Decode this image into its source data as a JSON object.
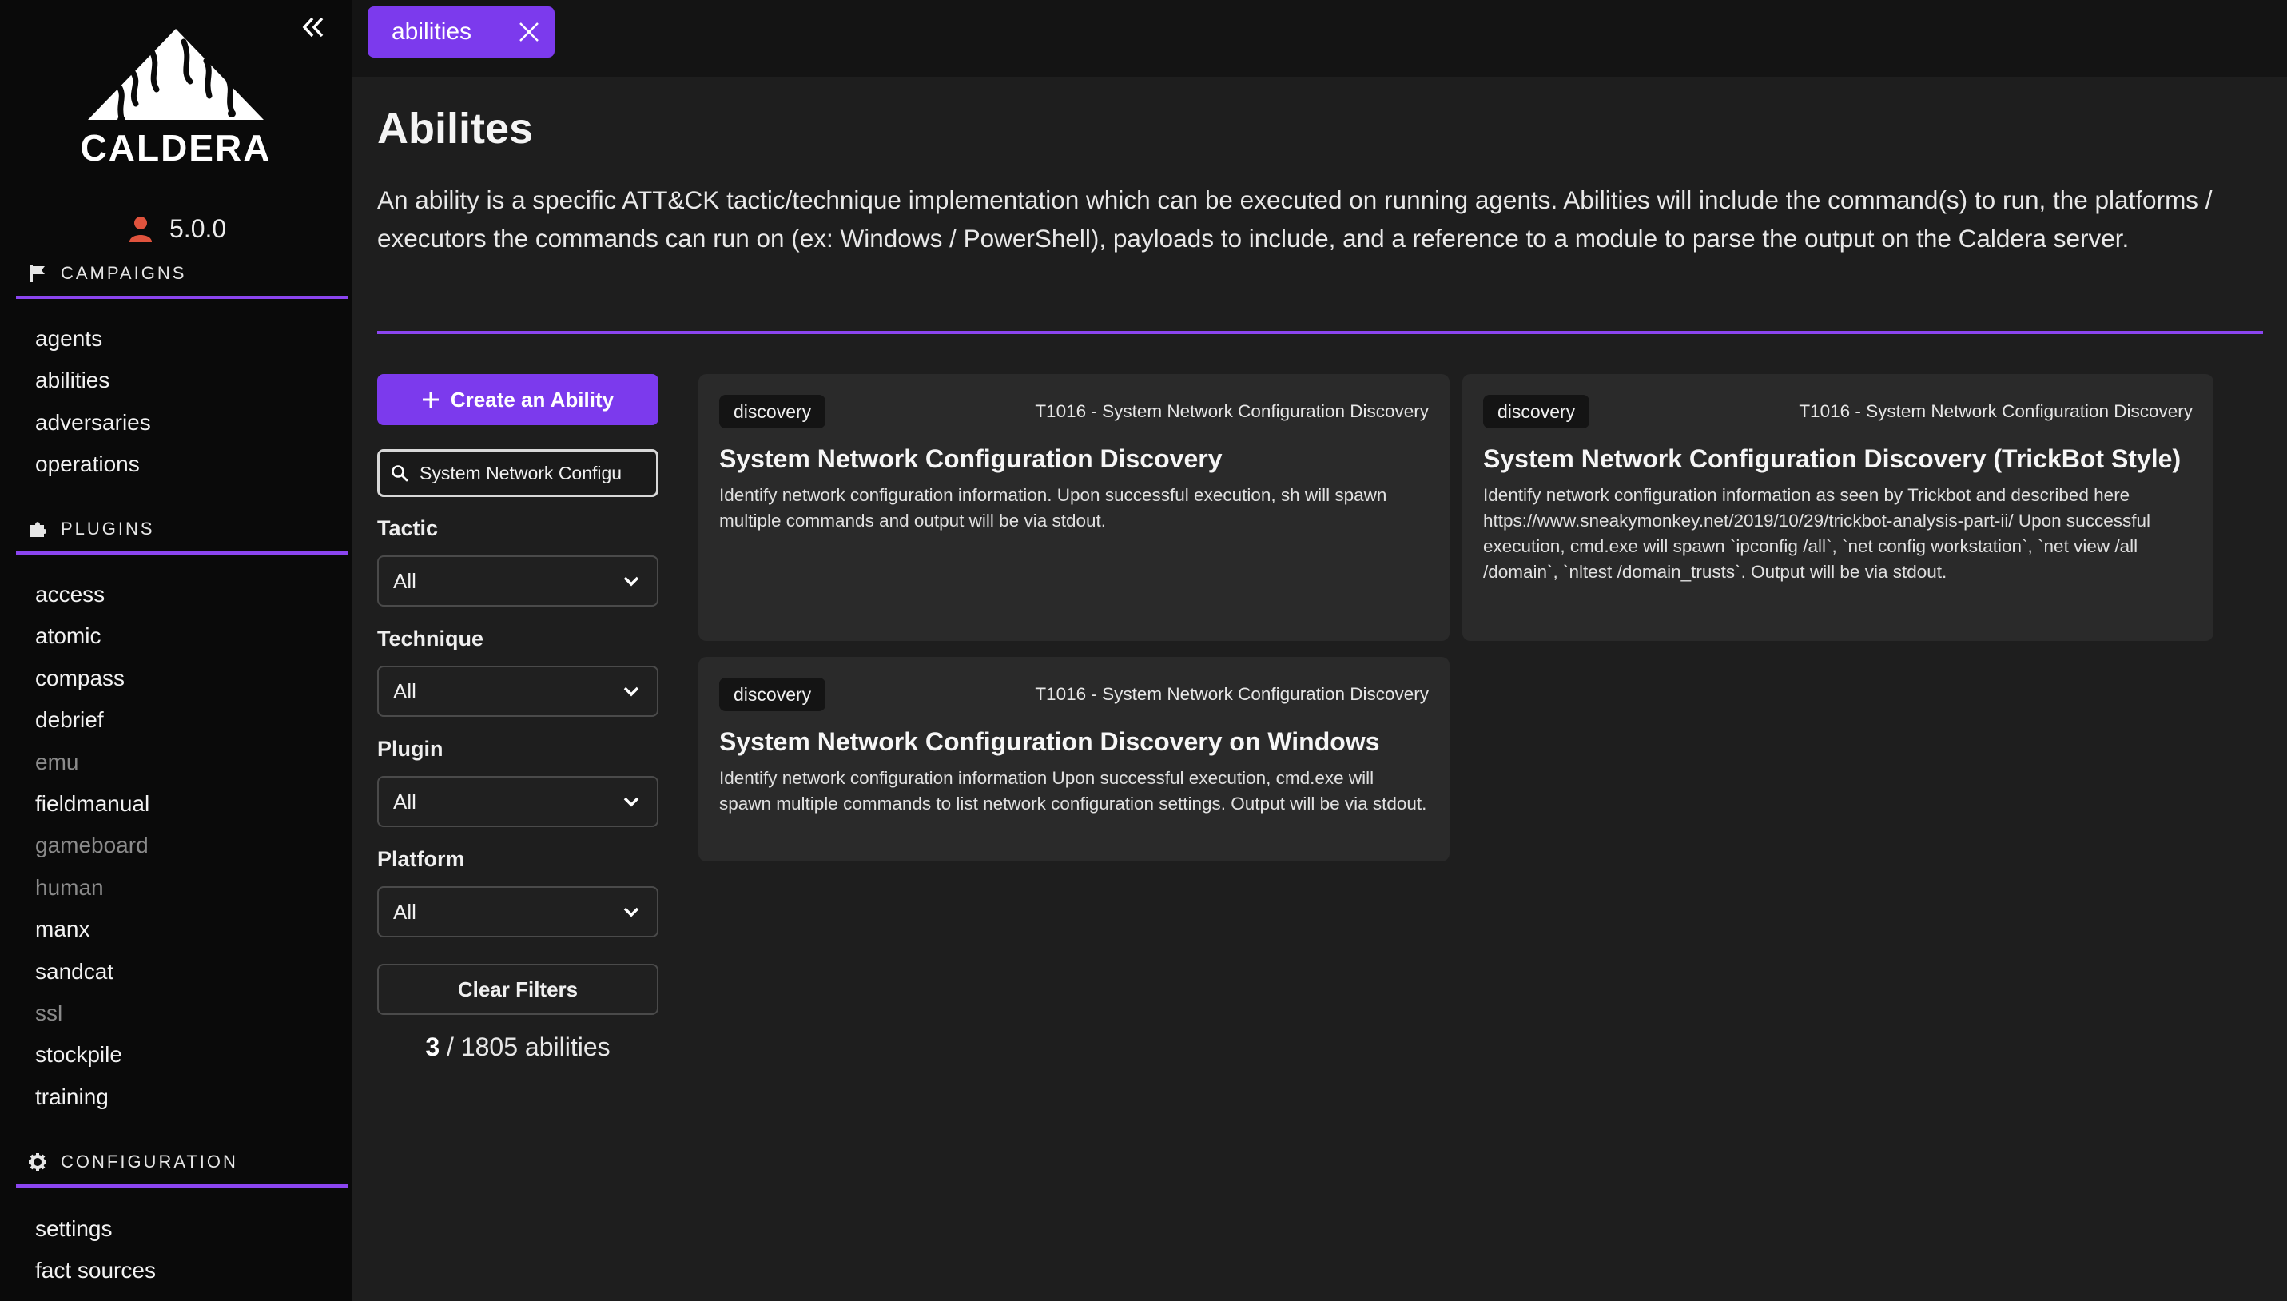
{
  "app": {
    "logo_text": "CALDERA",
    "version": "5.0.0"
  },
  "sidebar": {
    "sections": [
      {
        "label": "CAMPAIGNS",
        "icon": "flag-icon",
        "items": [
          {
            "label": "agents",
            "dim": false
          },
          {
            "label": "abilities",
            "dim": false
          },
          {
            "label": "adversaries",
            "dim": false
          },
          {
            "label": "operations",
            "dim": false
          }
        ]
      },
      {
        "label": "PLUGINS",
        "icon": "puzzle-icon",
        "items": [
          {
            "label": "access",
            "dim": false
          },
          {
            "label": "atomic",
            "dim": false
          },
          {
            "label": "compass",
            "dim": false
          },
          {
            "label": "debrief",
            "dim": false
          },
          {
            "label": "emu",
            "dim": true
          },
          {
            "label": "fieldmanual",
            "dim": false
          },
          {
            "label": "gameboard",
            "dim": true
          },
          {
            "label": "human",
            "dim": true
          },
          {
            "label": "manx",
            "dim": false
          },
          {
            "label": "sandcat",
            "dim": false
          },
          {
            "label": "ssl",
            "dim": true
          },
          {
            "label": "stockpile",
            "dim": false
          },
          {
            "label": "training",
            "dim": false
          }
        ]
      },
      {
        "label": "CONFIGURATION",
        "icon": "gear-icon",
        "items": [
          {
            "label": "settings",
            "dim": false
          },
          {
            "label": "fact sources",
            "dim": false
          }
        ]
      }
    ]
  },
  "tabs": [
    {
      "label": "abilities"
    }
  ],
  "page": {
    "title": "Abilites",
    "description": "An ability is a specific ATT&CK tactic/technique implementation which can be executed on running agents. Abilities will include the command(s) to run, the platforms / executors the commands can run on (ex: Windows / PowerShell), payloads to include, and a reference to a module to parse the output on the Caldera server."
  },
  "filters": {
    "create_label": "Create an Ability",
    "search_value": "System Network Configu",
    "tactic": {
      "label": "Tactic",
      "value": "All"
    },
    "technique": {
      "label": "Technique",
      "value": "All"
    },
    "plugin": {
      "label": "Plugin",
      "value": "All"
    },
    "platform": {
      "label": "Platform",
      "value": "All"
    },
    "clear_label": "Clear Filters",
    "count_shown": "3",
    "count_total": "/ 1805 abilities"
  },
  "abilities": [
    {
      "tactic": "discovery",
      "technique": "T1016 - System Network Configuration Discovery",
      "name": "System Network Configuration Discovery",
      "description": "Identify network configuration information. Upon successful execution, sh will spawn multiple commands and output will be via stdout."
    },
    {
      "tactic": "discovery",
      "technique": "T1016 - System Network Configuration Discovery",
      "name": "System Network Configuration Discovery (TrickBot Style)",
      "description": "Identify network configuration information as seen by Trickbot and described here https://www.sneakymonkey.net/2019/10/29/trickbot-analysis-part-ii/ Upon successful execution, cmd.exe will spawn `ipconfig /all`, `net config workstation`, `net view /all /domain`, `nltest /domain_trusts`. Output will be via stdout."
    },
    {
      "tactic": "discovery",
      "technique": "T1016 - System Network Configuration Discovery",
      "name": "System Network Configuration Discovery on Windows",
      "description": "Identify network configuration information Upon successful execution, cmd.exe will spawn multiple commands to list network configuration settings. Output will be via stdout."
    }
  ],
  "colors": {
    "accent": "#7c3aed",
    "sidebar_bg": "#0a0a0a",
    "card_bg": "#2a2a2a",
    "user_icon": "#e0533d"
  }
}
